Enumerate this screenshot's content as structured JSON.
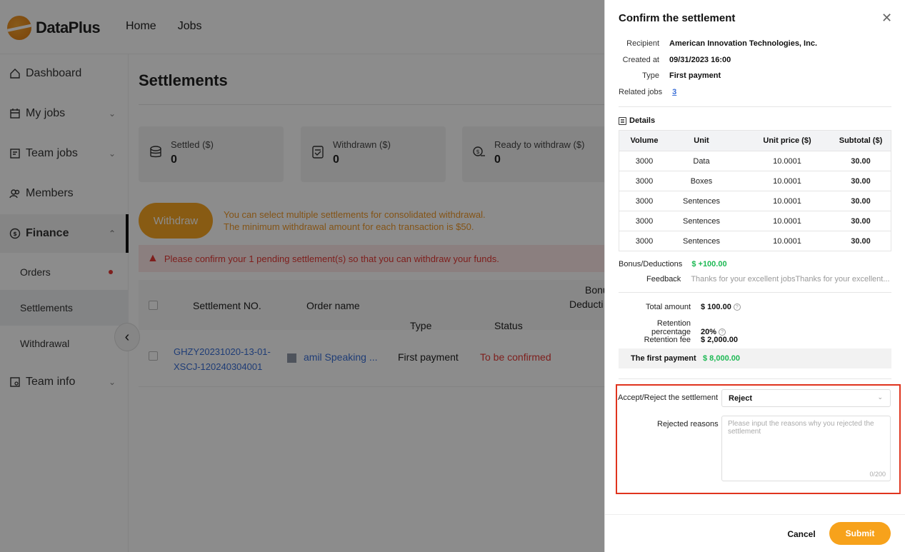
{
  "app": {
    "logo_text": "DataPlus",
    "nav": [
      "Home",
      "Jobs"
    ]
  },
  "sidebar": {
    "items": [
      {
        "label": "Dashboard",
        "icon": "home-icon"
      },
      {
        "label": "My jobs",
        "icon": "calendar-icon"
      },
      {
        "label": "Team jobs",
        "icon": "team-jobs-icon"
      },
      {
        "label": "Members",
        "icon": "members-icon"
      },
      {
        "label": "Finance",
        "icon": "finance-icon"
      },
      {
        "label": "Team info",
        "icon": "team-info-icon"
      }
    ],
    "finance_sub": [
      "Orders",
      "Settlements",
      "Withdrawal"
    ]
  },
  "main": {
    "title": "Settlements",
    "stats": [
      {
        "label": "Settled ($)",
        "value": "0"
      },
      {
        "label": "Withdrawn ($)",
        "value": "0"
      },
      {
        "label": "Ready to withdraw ($)",
        "value": "0"
      }
    ],
    "withdraw_label": "Withdraw",
    "withdraw_note_1": "You can select multiple settlements for consolidated withdrawal.",
    "withdraw_note_2": "The minimum withdrawal amount for each transaction is $50.",
    "alert": "Please confirm your 1 pending settlement(s) so that you can withdraw your funds.",
    "columns": [
      "Settlement NO.",
      "Order name",
      "Type",
      "Status",
      "Bonu",
      "Deducti"
    ],
    "row": {
      "settlement_no_1": "GHZY20231020-13-01-",
      "settlement_no_2": "XSCJ-120240304001",
      "order_name": "amil Speaking ...",
      "type": "First payment",
      "status": "To be confirmed"
    }
  },
  "drawer": {
    "title": "Confirm the settlement",
    "recipient_label": "Recipient",
    "recipient": "American Innovation Technologies, Inc.",
    "created_label": "Created at",
    "created": "09/31/2023 16:00",
    "type_label": "Type",
    "type": "First payment",
    "related_label": "Related jobs",
    "related": "3",
    "details_label": "Details",
    "table_headers": [
      "Volume",
      "Unit",
      "Unit price ($)",
      "Subtotal ($)"
    ],
    "table_rows": [
      [
        "3000",
        "Data",
        "10.0001",
        "30.00"
      ],
      [
        "3000",
        "Boxes",
        "10.0001",
        "30.00"
      ],
      [
        "3000",
        "Sentences",
        "10.0001",
        "30.00"
      ],
      [
        "3000",
        "Sentences",
        "10.0001",
        "30.00"
      ],
      [
        "3000",
        "Sentences",
        "10.0001",
        "30.00"
      ]
    ],
    "bonus_label": "Bonus/Deductions",
    "bonus": "$ +100.00",
    "feedback_label": "Feedback",
    "feedback": "Thanks for your excellent jobsThanks for your excellent...",
    "total_label": "Total amount",
    "total": "$ 100.00",
    "retention_pct_label": "Retention percentage",
    "retention_pct": "20%",
    "retention_fee_label": "Retention fee",
    "retention_fee": "$ 2,000.00",
    "first_payment_label": "The first payment",
    "first_payment": "$ 8,000.00",
    "accept_label": "Accept/Reject the settlement",
    "accept_value": "Reject",
    "reasons_label": "Rejected reasons",
    "reasons_placeholder": "Please input the reasons why you rejected the settlement",
    "reasons_count": "0/200",
    "cancel": "Cancel",
    "submit": "Submit"
  },
  "colors": {
    "accent": "#f7a21b",
    "link": "#3a6fd8",
    "danger": "#e53935",
    "success": "#1db954",
    "highlight_box": "#e0341e"
  }
}
